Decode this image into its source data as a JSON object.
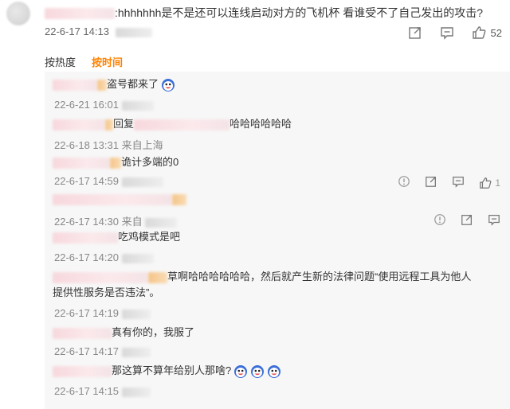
{
  "top_comment": {
    "text": ":hhhhhhh是不是还可以连线启动对方的飞机杯 看谁受不了自己发出的攻击?",
    "date": "22-6-17 14:13",
    "like_count": "52"
  },
  "tabs": [
    {
      "label": "按热度"
    },
    {
      "label": "按时间"
    }
  ],
  "replies": [
    {
      "text": "盗号都来了",
      "date": "22-6-21 16:01"
    },
    {
      "prefix": "回复",
      "text": "哈哈哈哈哈哈",
      "date": "22-6-18 13:31",
      "location": "来自上海"
    },
    {
      "text": "诡计多端的0",
      "date": "22-6-17 14:59",
      "like_count": "1"
    },
    {
      "text": "",
      "date": "22-6-17 14:30",
      "location": "来自"
    },
    {
      "text": "吃鸡模式是吧",
      "date": "22-6-17 14:20"
    },
    {
      "text": "草啊哈哈哈哈哈哈，然后就产生新的法律问题“使用远程工具为他人",
      "text2": "提供性服务是否违法”。",
      "date": "22-6-17 14:19"
    },
    {
      "text": "真有你的，我服了",
      "date": "22-6-17 14:17"
    },
    {
      "text": "那这算不算年给别人那啥?",
      "date": "22-6-17 14:15"
    }
  ],
  "colors": {
    "accent": "#ff8200",
    "panel_bg": "#f7f7f7"
  },
  "icons": [
    "share-icon",
    "comment-icon",
    "like-icon",
    "report-icon",
    "emoji-face-icon"
  ]
}
